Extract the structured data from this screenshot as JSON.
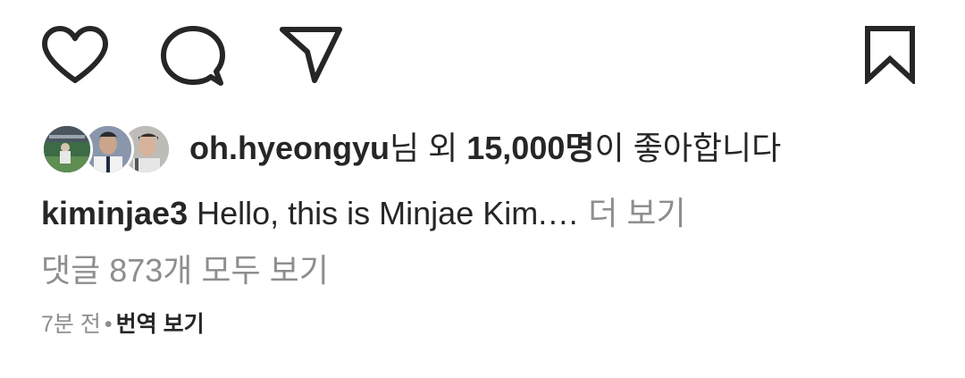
{
  "actions": {
    "like_icon": "heart-outline-icon",
    "comment_icon": "comment-bubble-icon",
    "share_icon": "paper-plane-icon",
    "save_icon": "bookmark-outline-icon"
  },
  "likes": {
    "username": "oh.hyeongyu",
    "suffix_1": "님 외 ",
    "count": "15,000명",
    "suffix_2": "이 좋아합니다"
  },
  "caption": {
    "username": "kiminjae3",
    "text": " Hello, this is Minjae Kim.… ",
    "more_label": "더 보기"
  },
  "comments": {
    "view_all_label": "댓글 873개 모두 보기"
  },
  "meta": {
    "timestamp": "7분 전",
    "separator": "•",
    "translate_label": "번역 보기"
  },
  "colors": {
    "text_primary": "#262626",
    "text_secondary": "#8e8e8e",
    "background": "#ffffff"
  }
}
